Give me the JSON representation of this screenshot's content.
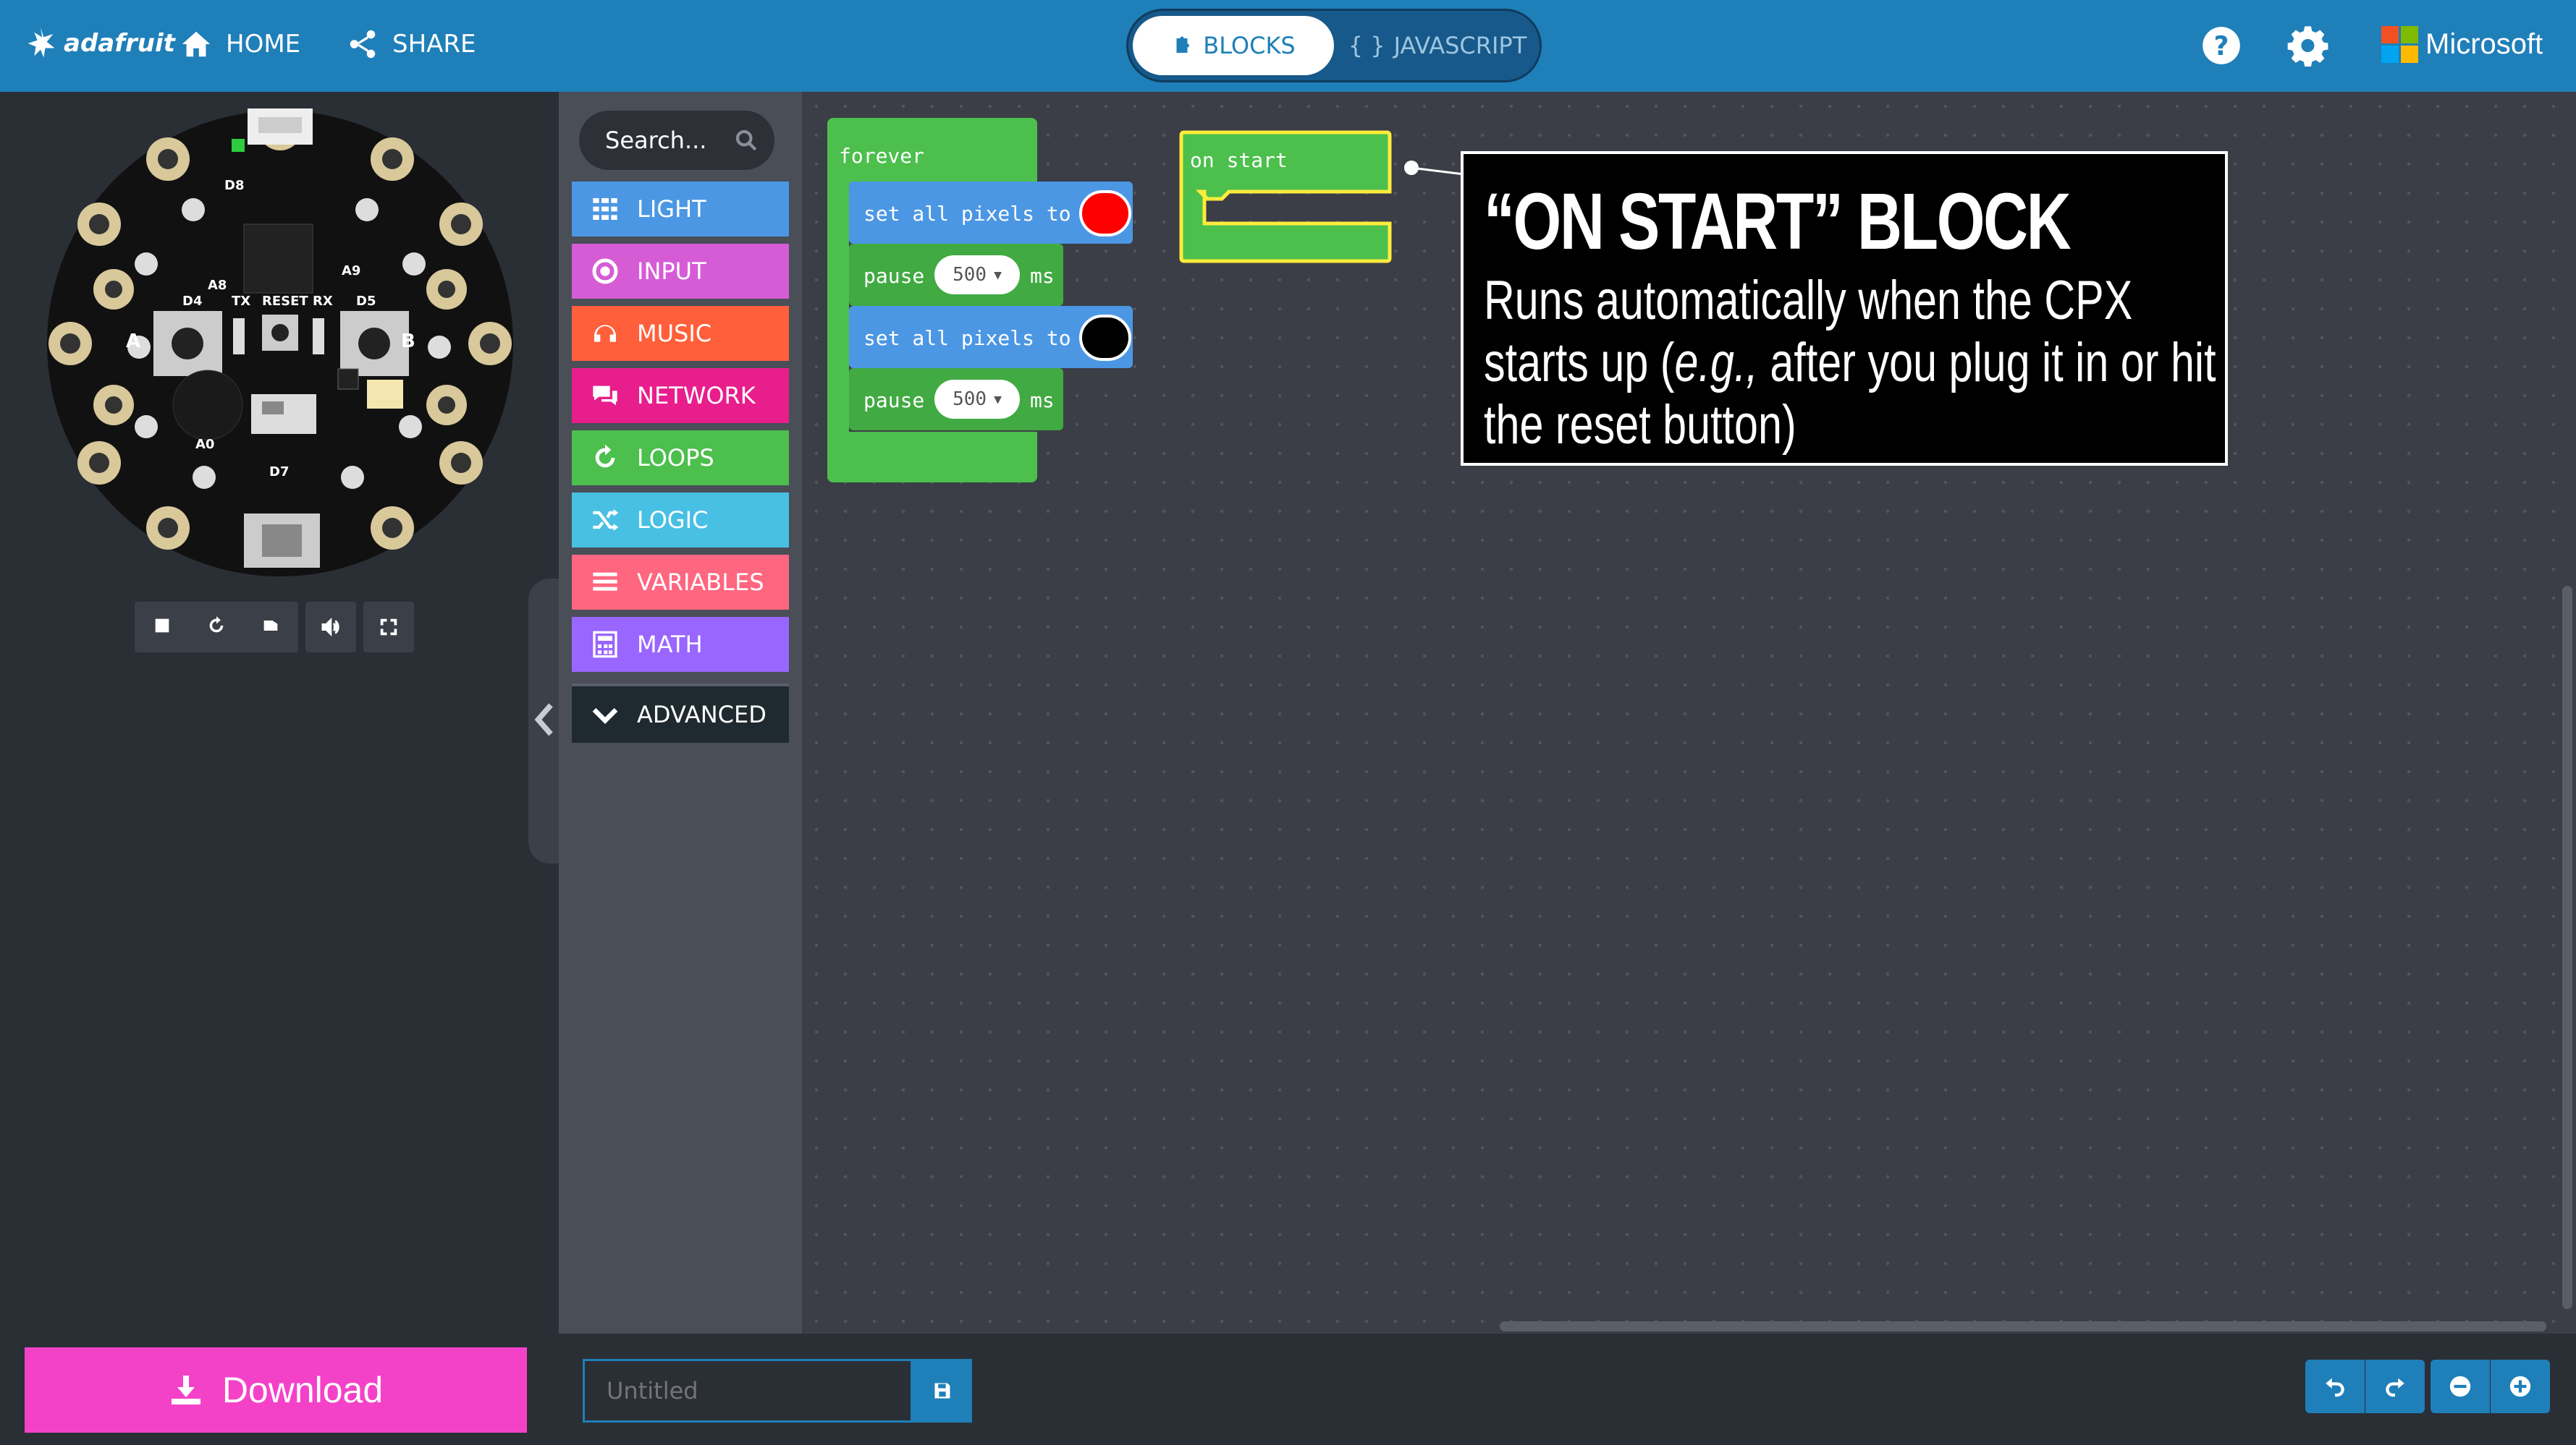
{
  "header": {
    "logo_text": "adafruit",
    "home_label": "HOME",
    "share_label": "SHARE",
    "tab_blocks": "BLOCKS",
    "tab_javascript": "JAVASCRIPT",
    "brand": "Microsoft"
  },
  "toolbox": {
    "search_placeholder": "Search...",
    "categories": [
      {
        "label": "LIGHT",
        "color": "#4c97e4"
      },
      {
        "label": "INPUT",
        "color": "#d65cd6"
      },
      {
        "label": "MUSIC",
        "color": "#ff5f3a"
      },
      {
        "label": "NETWORK",
        "color": "#e81e8c"
      },
      {
        "label": "LOOPS",
        "color": "#4cbf4d"
      },
      {
        "label": "LOGIC",
        "color": "#48c0e4"
      },
      {
        "label": "VARIABLES",
        "color": "#ff6680"
      },
      {
        "label": "MATH",
        "color": "#9966ff"
      },
      {
        "label": "ADVANCED",
        "color": "#1f2a30"
      }
    ]
  },
  "workspace": {
    "forever_label": "forever",
    "set_pixels_label": "set all pixels to",
    "pause_label": "pause",
    "pause_value": "500",
    "ms_label": "ms",
    "color_red": "#ff0000",
    "color_black": "#000000",
    "on_start_label": "on start"
  },
  "callout": {
    "title": "“ON START” BLOCK",
    "body_1": "Runs automatically when the CPX starts up (",
    "body_em": "e.g.,",
    "body_2": " after you plug it in or hit the reset button)"
  },
  "bottom": {
    "download_label": "Download",
    "project_placeholder": "Untitled"
  },
  "icons": {
    "stop": "stop-icon",
    "restart": "restart-icon",
    "slowmo": "slow-motion-icon",
    "sound": "sound-icon",
    "fullscreen": "fullscreen-icon",
    "undo": "undo-icon",
    "redo": "redo-icon",
    "zoom_out": "zoom-out-icon",
    "zoom_in": "zoom-in-icon"
  }
}
